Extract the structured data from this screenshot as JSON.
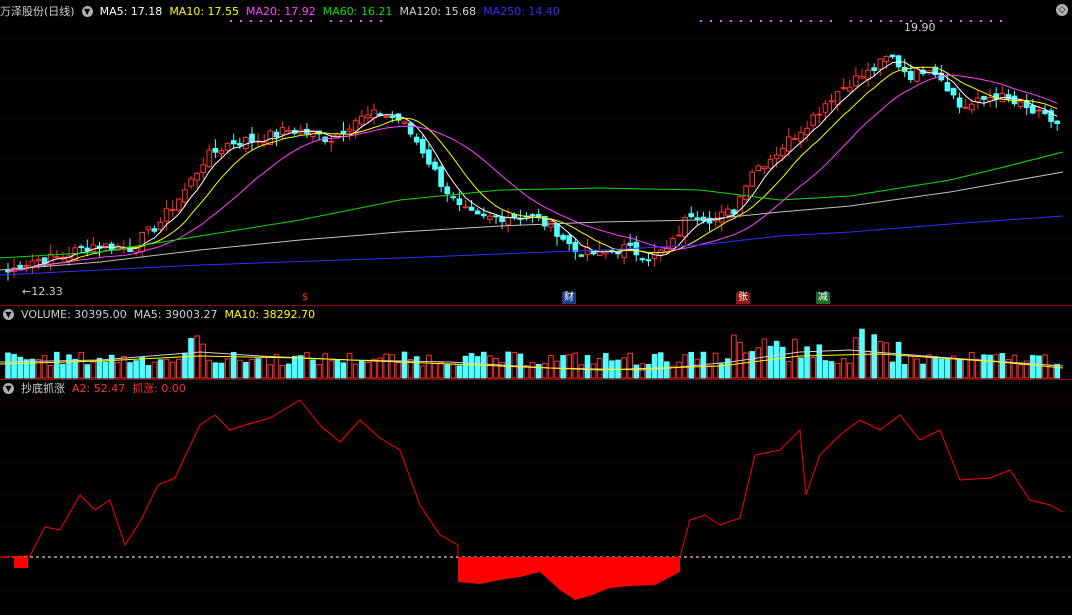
{
  "stock_title": "万泽股份(日线)",
  "price_legend": [
    {
      "label": "MA5: 17.18",
      "color": "#ffffff"
    },
    {
      "label": "MA10: 17.55",
      "color": "#ffff00"
    },
    {
      "label": "MA20: 17.92",
      "color": "#ff40ff"
    },
    {
      "label": "MA60: 16.21",
      "color": "#00e000"
    },
    {
      "label": "MA120: 15.68",
      "color": "#d0d0d0"
    },
    {
      "label": "MA250: 14.40",
      "color": "#3030ff"
    }
  ],
  "volume_legend": [
    {
      "label": "VOLUME: 30395.00",
      "color": "#d0d0d0"
    },
    {
      "label": "MA5: 39003.27",
      "color": "#d0d0d0"
    },
    {
      "label": "MA10: 38292.70",
      "color": "#ffff00"
    }
  ],
  "indicator_title": "抄底抓涨",
  "indicator_legend": [
    {
      "label": "A2: 52.47",
      "color": "#ff3030"
    },
    {
      "label": "抓涨: 0.00",
      "color": "#ff3030"
    }
  ],
  "high_label": "19.90",
  "low_label": "←12.33",
  "event_markers": [
    {
      "label": "$",
      "color": "#ff3030",
      "bg": ""
    },
    {
      "label": "财",
      "color": "#ffffff",
      "bg": "#1e3c8c"
    },
    {
      "label": "张",
      "color": "#ffffff",
      "bg": "#8b1a1a"
    },
    {
      "label": "减",
      "color": "#ffffff",
      "bg": "#1a6e2a"
    }
  ],
  "colors": {
    "up": "#ff3030",
    "down": "#54ffff",
    "grid": "#8b0000",
    "indicator": "#ff0000"
  }
}
